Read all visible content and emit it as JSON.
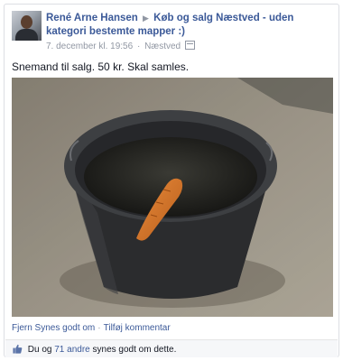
{
  "post": {
    "author": "René Arne Hansen",
    "group": "Køb og salg Næstved - uden kategori bestemte mapper :)",
    "date": "7. december kl. 19:56",
    "location": "Næstved",
    "text": "Snemand til salg. 50 kr. Skal samles.",
    "photo_icon": "bucket-with-carrot-photo"
  },
  "actions": {
    "unlike": "Fjern Synes godt om",
    "separator": "·",
    "comment": "Tilføj kommentar"
  },
  "likes": {
    "prefix": "Du og",
    "count": "71 andre",
    "suffix": "synes godt om dette.",
    "icon": "thumbs-up-icon"
  },
  "colors": {
    "link": "#3b5998",
    "muted": "#9197a3",
    "likes_bg": "#f6f7f9"
  }
}
